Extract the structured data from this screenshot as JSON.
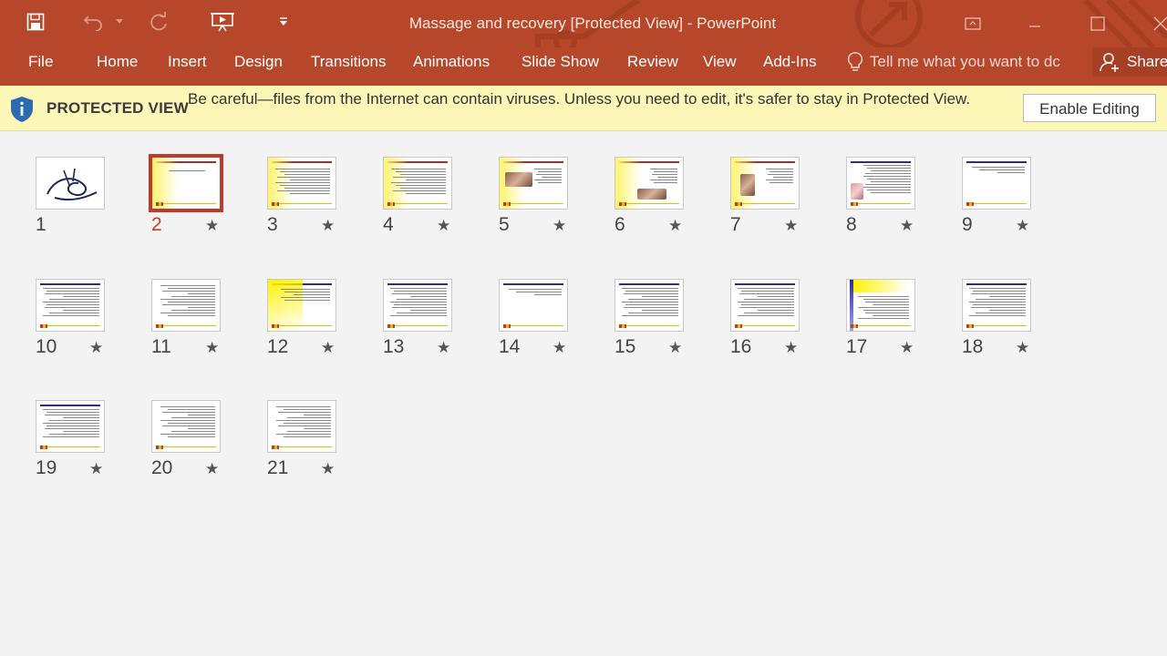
{
  "window": {
    "title": "Massage and recovery [Protected View] - PowerPoint"
  },
  "quick_access": {
    "icons": [
      "save-icon",
      "undo-icon",
      "undo-dropdown-icon",
      "redo-icon",
      "present-from-beginning-icon",
      "customize-qat-icon"
    ]
  },
  "ribbon": {
    "tabs": [
      "File",
      "Home",
      "Insert",
      "Design",
      "Transitions",
      "Animations",
      "Slide Show",
      "Review",
      "View",
      "Add-Ins"
    ],
    "tell_me": "Tell me what you want to dc",
    "share": "Share"
  },
  "protected_view": {
    "label": "PROTECTED VIEW",
    "message": "Be careful—files from the Internet can contain viruses. Unless you need to edit, it's safer to stay in Protected View.",
    "button": "Enable Editing"
  },
  "slides": [
    {
      "number": "1",
      "star": "",
      "style": "logo"
    },
    {
      "number": "2",
      "star": "★",
      "style": "title",
      "selected": true
    },
    {
      "number": "3",
      "star": "★",
      "style": "text-red"
    },
    {
      "number": "4",
      "star": "★",
      "style": "text-red"
    },
    {
      "number": "5",
      "star": "★",
      "style": "photo-red"
    },
    {
      "number": "6",
      "star": "★",
      "style": "photo-red2"
    },
    {
      "number": "7",
      "star": "★",
      "style": "photo-red3"
    },
    {
      "number": "8",
      "star": "★",
      "style": "photo-blue"
    },
    {
      "number": "9",
      "star": "★",
      "style": "text-blue-short"
    },
    {
      "number": "10",
      "star": "★",
      "style": "text-blue"
    },
    {
      "number": "11",
      "star": "★",
      "style": "text-plain"
    },
    {
      "number": "12",
      "star": "★",
      "style": "yellow"
    },
    {
      "number": "13",
      "star": "★",
      "style": "text-blue"
    },
    {
      "number": "14",
      "star": "★",
      "style": "text-blue-short"
    },
    {
      "number": "15",
      "star": "★",
      "style": "text-blue"
    },
    {
      "number": "16",
      "star": "★",
      "style": "text-blue"
    },
    {
      "number": "17",
      "star": "★",
      "style": "yellow-blue"
    },
    {
      "number": "18",
      "star": "★",
      "style": "text-blue"
    },
    {
      "number": "19",
      "star": "★",
      "style": "text-blue"
    },
    {
      "number": "20",
      "star": "★",
      "style": "text-plain"
    },
    {
      "number": "21",
      "star": "★",
      "style": "text-plain"
    }
  ],
  "colors": {
    "accent": "#b7472a",
    "protected_bar": "#fcf7b6",
    "selection": "#c0392b"
  }
}
